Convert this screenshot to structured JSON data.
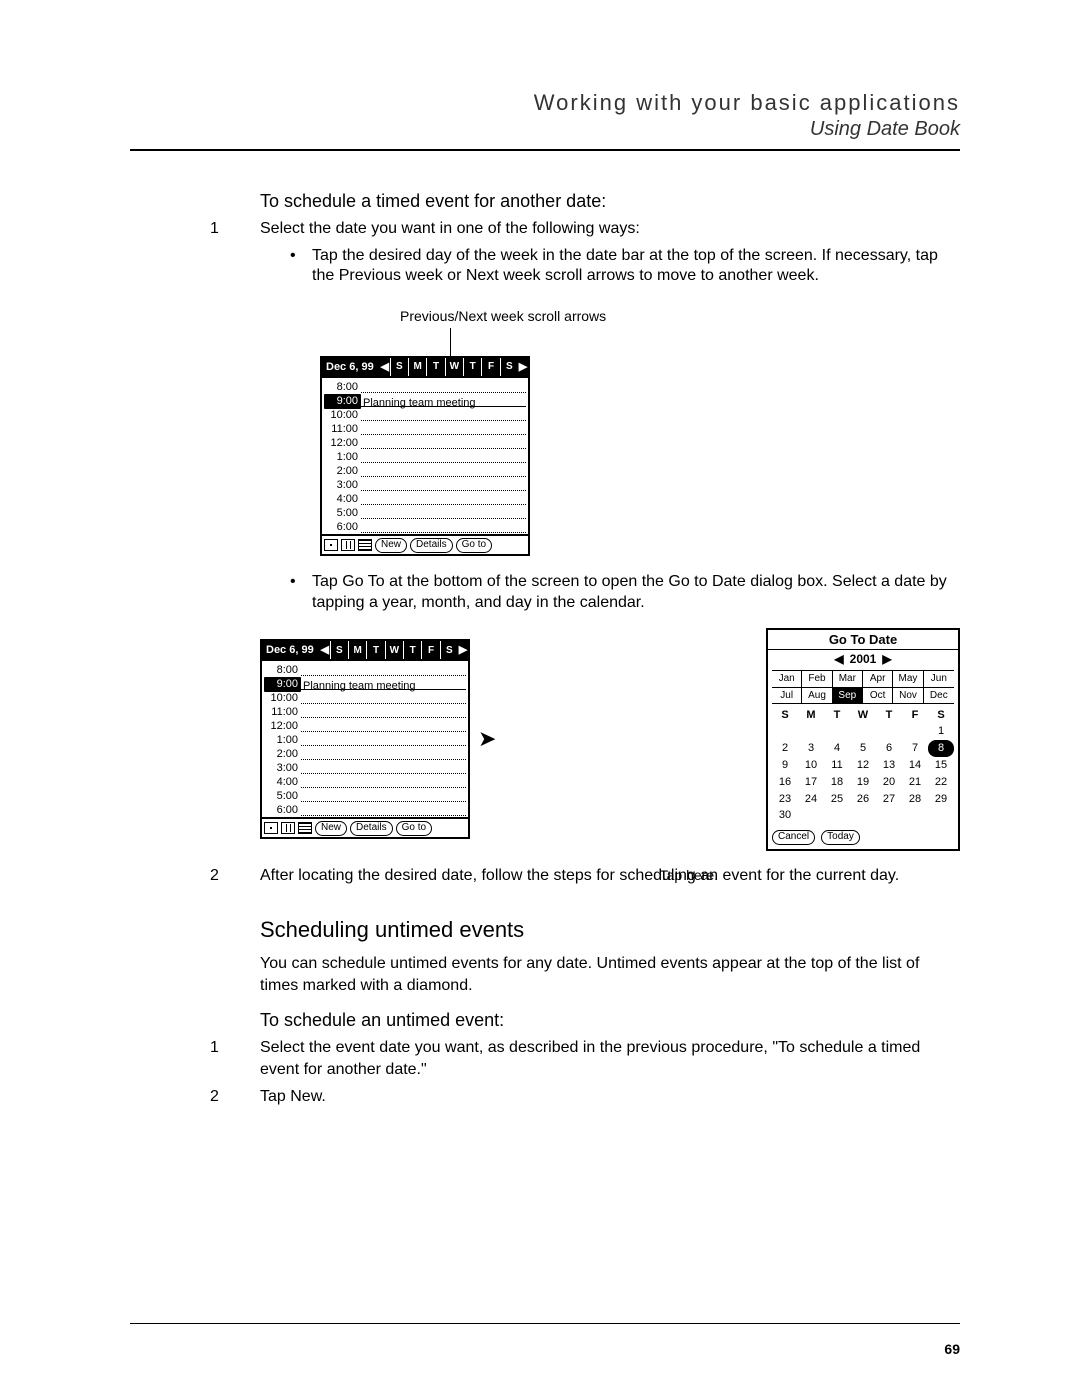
{
  "header": {
    "chapter": "Working with your basic applications",
    "section": "Using Date Book"
  },
  "page_number": "69",
  "proc1_heading": "To schedule a timed event for another date:",
  "step1_num": "1",
  "step1_text": "Select the date you want in one of the following ways:",
  "bullet1": "Tap the desired day of the week in the date bar at the top of the screen. If necessary, tap the Previous week or Next week scroll arrows to move to another week.",
  "callout_prevnext": "Previous/Next week scroll arrows",
  "bullet2": "Tap Go To at the bottom of the screen to open the Go to Date dialog box. Select a date by tapping a year, month, and day in the calendar.",
  "tap_here": "Tap here.",
  "step2_num": "2",
  "step2_text": "After locating the desired date, follow the steps for scheduling an event for the current day.",
  "h3_untimed": "Scheduling untimed events",
  "untimed_para": "You can schedule untimed events for any date. Untimed events appear at the top of the list of times marked with a diamond.",
  "proc2_heading": "To schedule an untimed event:",
  "p2_step1_num": "1",
  "p2_step1_text": "Select the event date you want, as described in the previous procedure, \"To schedule a timed event for another date.\"",
  "p2_step2_num": "2",
  "p2_step2_text": "Tap New.",
  "datebook": {
    "date": "Dec 6, 99",
    "days": [
      "S",
      "M",
      "T",
      "W",
      "T",
      "F",
      "S"
    ],
    "event_time": "9:00",
    "event_text": "Planning team meeting",
    "times": [
      "8:00",
      "9:00",
      "10:00",
      "11:00",
      "12:00",
      "1:00",
      "2:00",
      "3:00",
      "4:00",
      "5:00",
      "6:00"
    ],
    "buttons": {
      "new": "New",
      "details": "Details",
      "goto": "Go to"
    }
  },
  "gotodate": {
    "title": "Go To Date",
    "year": "2001",
    "months": [
      "Jan",
      "Feb",
      "Mar",
      "Apr",
      "May",
      "Jun",
      "Jul",
      "Aug",
      "Sep",
      "Oct",
      "Nov",
      "Dec"
    ],
    "sel_month_index": 8,
    "dow": [
      "S",
      "M",
      "T",
      "W",
      "T",
      "F",
      "S"
    ],
    "weeks": [
      [
        "",
        "",
        "",
        "",
        "",
        "",
        "1"
      ],
      [
        "2",
        "3",
        "4",
        "5",
        "6",
        "7",
        "8"
      ],
      [
        "9",
        "10",
        "11",
        "12",
        "13",
        "14",
        "15"
      ],
      [
        "16",
        "17",
        "18",
        "19",
        "20",
        "21",
        "22"
      ],
      [
        "23",
        "24",
        "25",
        "26",
        "27",
        "28",
        "29"
      ],
      [
        "30",
        "",
        "",
        "",
        "",
        "",
        ""
      ]
    ],
    "sel_day": "8",
    "buttons": {
      "cancel": "Cancel",
      "today": "Today"
    }
  }
}
